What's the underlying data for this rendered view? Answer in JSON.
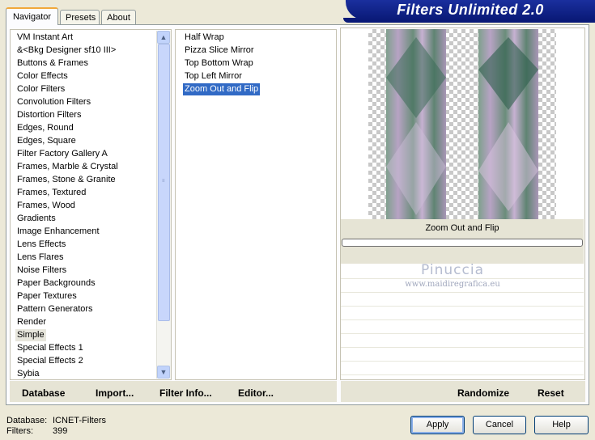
{
  "tabs": [
    {
      "label": "Navigator",
      "active": true
    },
    {
      "label": "Presets",
      "active": false
    },
    {
      "label": "About",
      "active": false
    }
  ],
  "banner": {
    "title": "Filters Unlimited 2.0"
  },
  "categories": [
    "VM Instant Art",
    "&<Bkg Designer sf10 III>",
    "Buttons & Frames",
    "Color Effects",
    "Color Filters",
    "Convolution Filters",
    "Distortion Filters",
    "Edges, Round",
    "Edges, Square",
    "Filter Factory Gallery A",
    "Frames, Marble & Crystal",
    "Frames, Stone & Granite",
    "Frames, Textured",
    "Frames, Wood",
    "Gradients",
    "Image Enhancement",
    "Lens Effects",
    "Lens Flares",
    "Noise Filters",
    "Paper Backgrounds",
    "Paper Textures",
    "Pattern Generators",
    "Render",
    "Simple",
    "Special Effects 1",
    "Special Effects 2",
    "Sybia"
  ],
  "selected_category": "Simple",
  "filters": [
    "Half Wrap",
    "Pizza Slice Mirror",
    "Top Bottom Wrap",
    "Top Left Mirror",
    "Zoom Out and Flip"
  ],
  "selected_filter": "Zoom Out and Flip",
  "preview": {
    "caption": "Zoom Out and Flip"
  },
  "watermark": {
    "name": "Pinuccia",
    "site": "www.maidiregrafica.eu"
  },
  "toolbar": {
    "database": "Database",
    "import": "Import...",
    "filter_info": "Filter Info...",
    "editor": "Editor...",
    "randomize": "Randomize",
    "reset": "Reset"
  },
  "status": {
    "database_label": "Database:",
    "database_value": "ICNET-Filters",
    "filters_label": "Filters:",
    "filters_value": "399"
  },
  "buttons": {
    "apply": "Apply",
    "cancel": "Cancel",
    "help": "Help"
  },
  "colors": {
    "selection": "#316ac5",
    "banner": "#0a1a78",
    "tab_highlight": "#f1a83a"
  }
}
